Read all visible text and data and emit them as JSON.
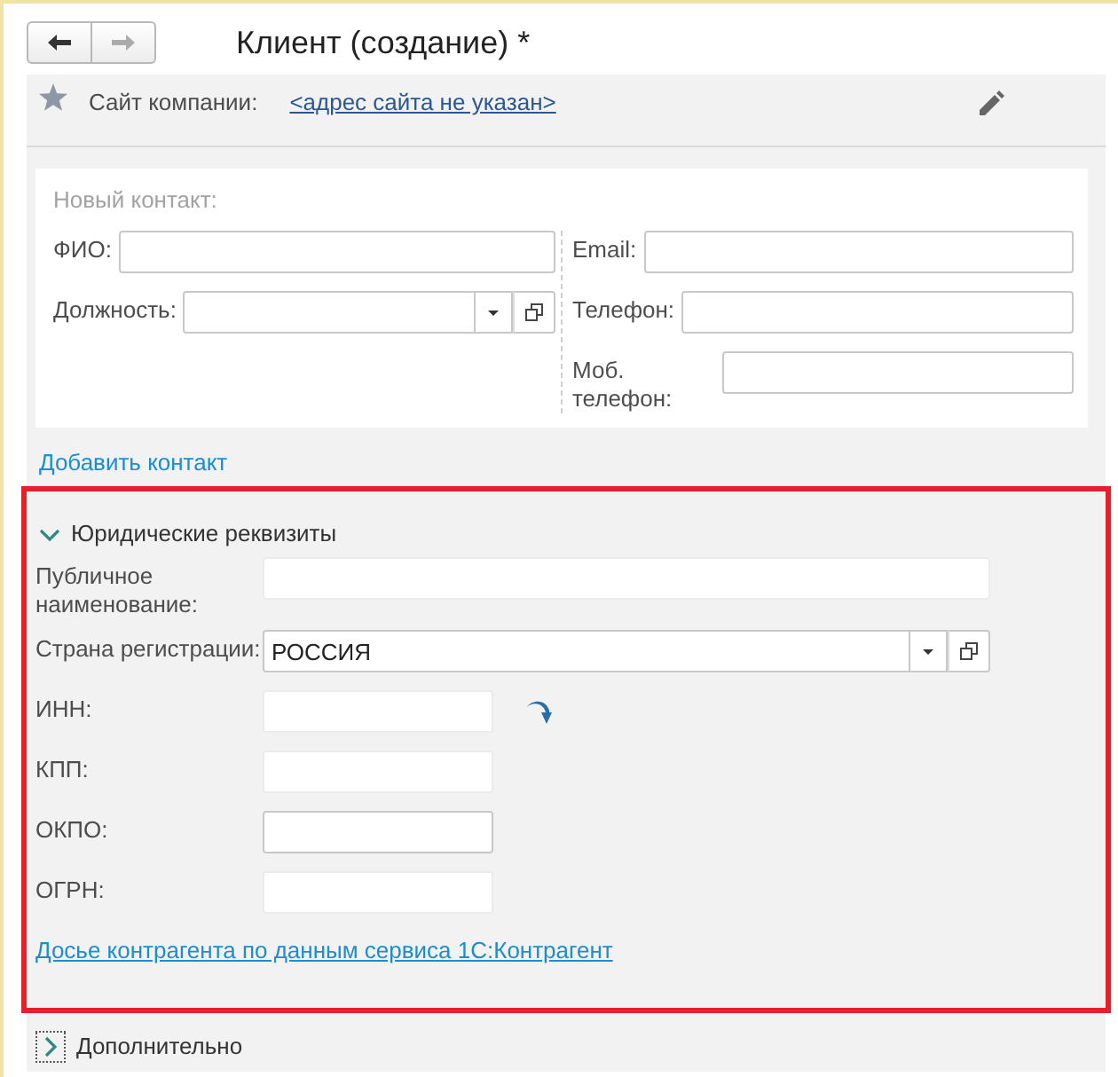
{
  "window": {
    "title": "Клиент (создание) *"
  },
  "nav_buttons": [
    {
      "kind": "back",
      "disabled": false
    },
    {
      "kind": "forward",
      "disabled": true
    }
  ],
  "website": {
    "label": "Сайт компании:",
    "link": "<адрес сайта не указан>"
  },
  "new_contact": {
    "heading": "Новый контакт:",
    "columns": [
      {
        "fields": [
          {
            "label": "ФИО:",
            "kind": "text"
          },
          {
            "label": "Должность:",
            "kind": "dropdown"
          }
        ]
      },
      {
        "fields": [
          {
            "label": "Email:",
            "kind": "text"
          },
          {
            "label": "Телефон:",
            "kind": "text"
          },
          {
            "label": "Моб. телефон:",
            "kind": "text"
          }
        ]
      }
    ]
  },
  "add_contact_link": "Добавить контакт",
  "legal_details": {
    "title": "Юридические реквизиты",
    "expanded": true,
    "highlighted": true,
    "fields": [
      {
        "label": "Публичное наименование:",
        "kind": "text",
        "obscured": true
      },
      {
        "label": "Страна регистрации:",
        "kind": "dropdown",
        "value": "РОССИЯ"
      },
      {
        "label": "ИНН:",
        "kind": "code-fill",
        "obscured": true
      },
      {
        "label": "КПП:",
        "kind": "code",
        "obscured": true
      },
      {
        "label": "ОКПО:",
        "kind": "code",
        "obscured": false
      },
      {
        "label": "ОГРН:",
        "kind": "code",
        "obscured": true
      }
    ],
    "link": "Досье контрагента по данным сервиса 1С:Контрагент"
  },
  "additional": {
    "title": "Дополнительно",
    "expanded": false,
    "focused": true
  }
}
